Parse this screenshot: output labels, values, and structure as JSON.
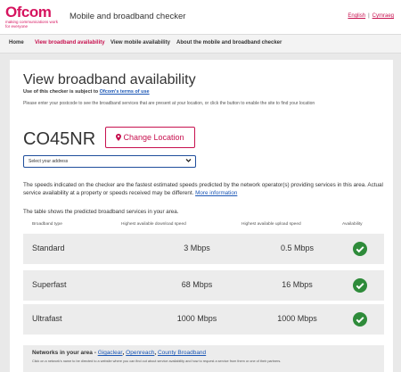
{
  "header": {
    "logo": "Ofcom",
    "logo_tagline": "making communications work for everyone",
    "title": "Mobile and broadband checker",
    "lang_en": "English",
    "lang_cy": "Cymraeg"
  },
  "nav": {
    "items": [
      {
        "label": "Home"
      },
      {
        "label": "View broadband availability"
      },
      {
        "label": "View mobile availability"
      },
      {
        "label": "About the mobile and broadband checker"
      }
    ]
  },
  "page": {
    "heading": "View broadband availability",
    "terms_prefix": "Use of this checker is subject to ",
    "terms_link": "Ofcom's terms of use",
    "intro": "Please enter your postcode to see the broadband services that are present at your location, or click the button to enable the site to find your location",
    "postcode": "CO45NR",
    "change_location": "Change Location",
    "address_select": "Select your address",
    "note": "The speeds indicated on the checker are the fastest estimated speeds predicted by the network operator(s) providing services in this area. Actual service availability at a property or speeds received may be different.",
    "note_link": "More information",
    "table_intro": "The table shows the predicted broadband services in your area."
  },
  "table": {
    "headers": [
      "Broadband type",
      "Highest available download speed",
      "Highest available upload speed",
      "Availability"
    ],
    "rows": [
      {
        "type": "Standard",
        "download": "3 Mbps",
        "upload": "0.5 Mbps"
      },
      {
        "type": "Superfast",
        "download": "68 Mbps",
        "upload": "16 Mbps"
      },
      {
        "type": "Ultrafast",
        "download": "1000 Mbps",
        "upload": "1000 Mbps"
      }
    ]
  },
  "networks": {
    "title": "Networks in your area",
    "sep": " - ",
    "links": [
      "Gigaclear",
      "Openreach",
      "County Broadband"
    ],
    "note": "Click on a network's name to be directed to a website where you can find out about service availability and how to request a service from them or one of their partners."
  },
  "colors": {
    "brand": "#c7114f",
    "link": "#1a56b5",
    "check": "#2e8b3a"
  },
  "icons": {
    "location": "map-pin-icon",
    "dropdown": "chevron-down-icon",
    "available": "check-circle-icon"
  }
}
